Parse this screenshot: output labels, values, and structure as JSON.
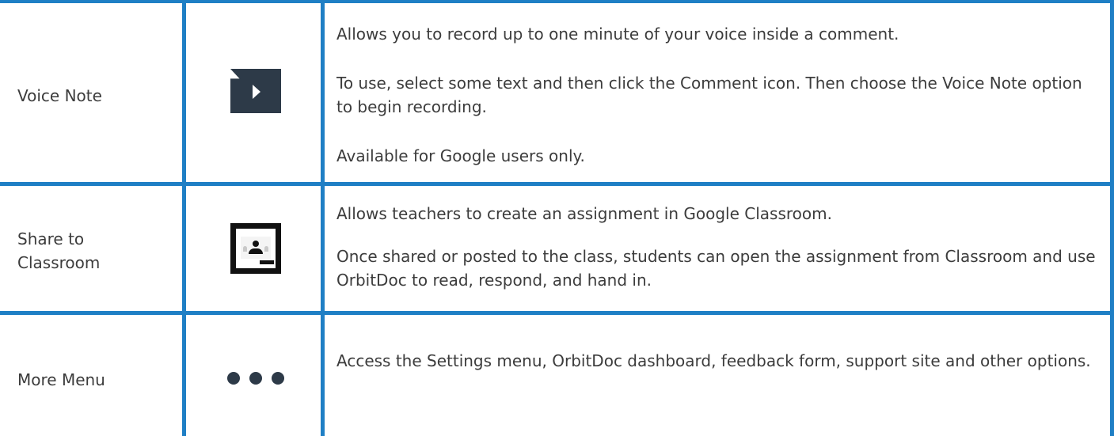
{
  "rows": [
    {
      "label": "Voice Note",
      "icon": "voice-note-icon",
      "description": [
        "Allows you to record up to one minute of your voice inside a comment.",
        "To use, select some text and then click the Comment icon. Then choose the Voice Note option to begin recording.",
        "Available for Google users only."
      ]
    },
    {
      "label": "Share to Classroom",
      "icon": "classroom-icon",
      "description": [
        "Allows teachers to create an assignment in Google Classroom.",
        "Once shared or posted to the class, students can open the assignment from Classroom and use OrbitDoc to read, respond, and hand in."
      ]
    },
    {
      "label": "More Menu",
      "icon": "more-dots-icon",
      "description": [
        "Access the Settings menu, OrbitDoc dashboard, feedback form, support site and other options."
      ]
    }
  ],
  "colors": {
    "grid": "#1f7fc5",
    "icon_dark": "#2d3a48",
    "text": "#3c3c3c"
  }
}
